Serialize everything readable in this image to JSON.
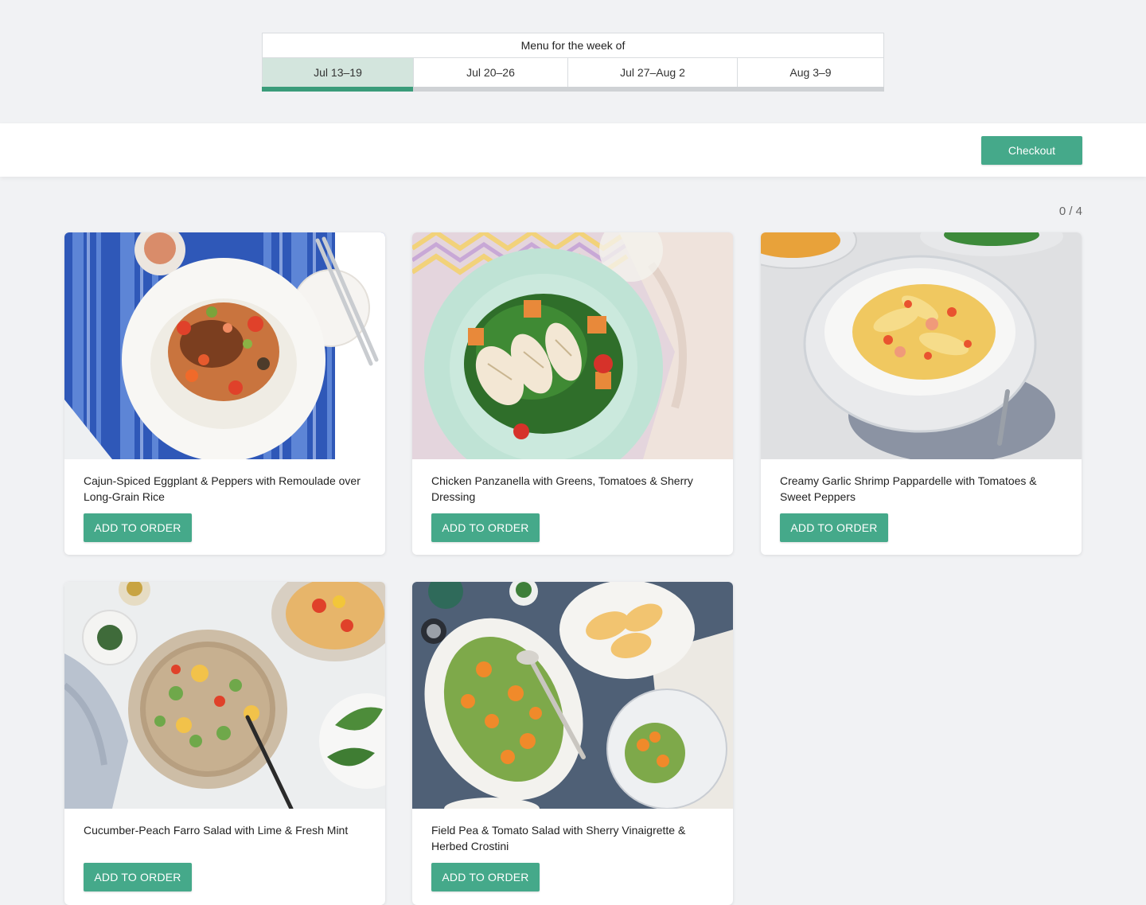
{
  "week_selector": {
    "header": "Menu for the week of",
    "tabs": [
      {
        "label": "Jul 13–19",
        "active": true
      },
      {
        "label": "Jul 20–26",
        "active": false
      },
      {
        "label": "Jul 27–Aug 2",
        "active": false
      },
      {
        "label": "Aug 3–9",
        "active": false
      }
    ],
    "progress_fraction": 0.243
  },
  "toolbar": {
    "checkout_label": "Checkout"
  },
  "order_count": "0 / 4",
  "meals": [
    {
      "title": "Cajun-Spiced Eggplant & Peppers with Remoulade over Long-Grain Rice",
      "button": "ADD TO ORDER"
    },
    {
      "title": "Chicken Panzanella with Greens, Tomatoes & Sherry Dressing",
      "button": "ADD TO ORDER"
    },
    {
      "title": "Creamy Garlic Shrimp Pappardelle with Tomatoes & Sweet Peppers",
      "button": "ADD TO ORDER"
    },
    {
      "title": "Cucumber-Peach Farro Salad with Lime & Fresh Mint",
      "button": "ADD TO ORDER"
    },
    {
      "title": "Field Pea & Tomato Salad with Sherry Vinaigrette & Herbed Crostini",
      "button": "ADD TO ORDER"
    }
  ],
  "colors": {
    "accent": "#45a98a",
    "progress": "#3a9c7a",
    "active_tab": "#d3e5dd",
    "page_bg": "#f1f2f4"
  }
}
